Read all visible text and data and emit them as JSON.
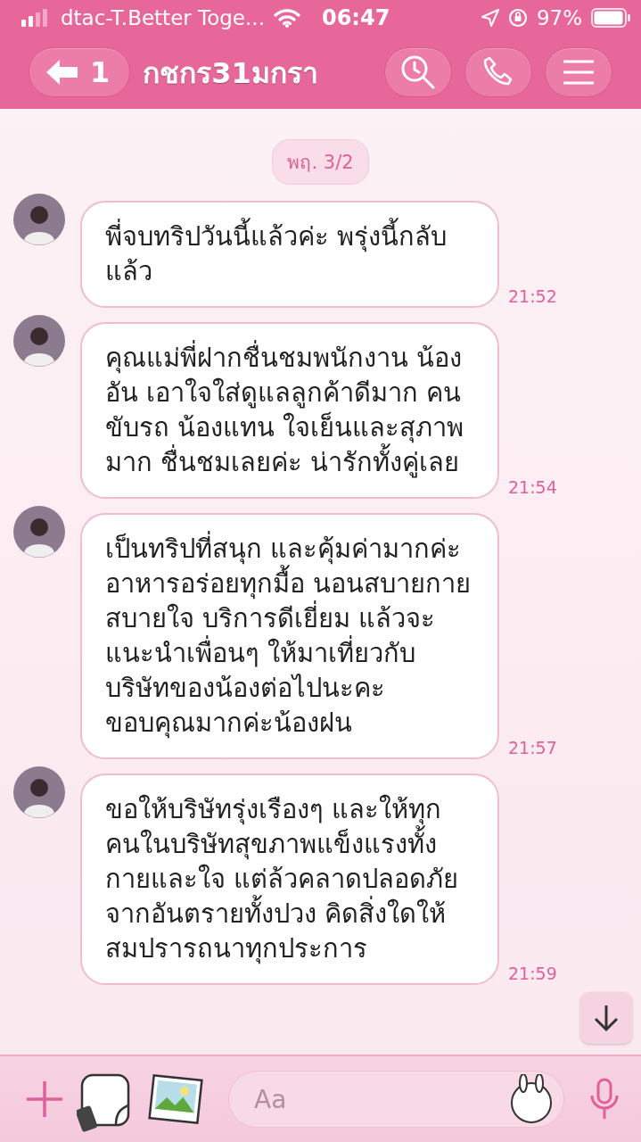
{
  "status_bar": {
    "carrier": "dtac-T.Better Toge...",
    "time": "06:47",
    "battery": "97%"
  },
  "header": {
    "back_count": "1",
    "title": "กชกร31มกรา"
  },
  "date_chip": "พฤ. 3/2",
  "messages": [
    {
      "text": "พี่จบทริปวันนี้แล้วค่ะ พรุ่งนี้กลับแล้ว",
      "time": "21:52"
    },
    {
      "text": "คุณแม่พี่ฝากชื่นชมพนักงาน น้องอัน เอาใจใส่ดูแลลูกค้าดีมาก คนขับรถ น้องแทน ใจเย็นและสุภาพมาก ชื่นชมเลยค่ะ น่ารักทั้งคู่เลย",
      "time": "21:54"
    },
    {
      "text": "เป็นทริปที่สนุก และคุ้มค่ามากค่ะ อาหารอร่อยทุกมื้อ นอนสบายกาย สบายใจ บริการดีเยี่ยม แล้วจะแนะนำเพื่อนๆ ให้มาเที่ยวกับบริษัทของน้องต่อไปนะคะ ขอบคุณมากค่ะน้องฝน",
      "time": "21:57"
    },
    {
      "text": "ขอให้บริษัทรุ่งเรืองๆ และให้ทุกคนในบริษัทสุขภาพแข็งแรงทั้งกายและใจ แต่ล้วคลาดปลอดภัยจากอันตรายทั้งปวง  คิดสิ่งใดให้สมปรารถนาทุกประการ",
      "time": "21:59"
    }
  ],
  "input": {
    "placeholder": "Aa"
  }
}
